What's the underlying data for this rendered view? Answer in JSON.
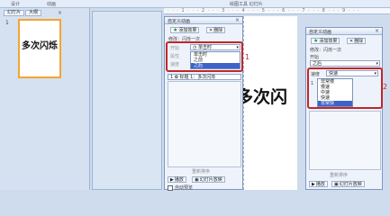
{
  "ribbon": {
    "title": "绘图工具 幻灯片",
    "tabs": [
      "设计",
      "动画"
    ]
  },
  "left_pane": {
    "tabs": [
      "幻灯片",
      "大纲"
    ],
    "close": "×",
    "thumbnail": {
      "number": "1",
      "text": "多次闪烁"
    }
  },
  "ruler": {
    "text": "· · · 1 · · · 2 · · · 3 · · · 4 · · · 5 · · · 6 · · · 7 · · · 8 · · · 9 · · ·"
  },
  "slide": {
    "text": "多次闪"
  },
  "panel1": {
    "title": "自定义动画",
    "close": "×",
    "add_effect": "添加效果",
    "remove": "删除",
    "modify_label": "修改：闪烁一次",
    "start_label": "开始",
    "start_value": "单击时",
    "property_label": "属性",
    "speed_label": "速度",
    "start_options": [
      "单击时",
      "之前",
      "之后"
    ],
    "selected_option": "之后",
    "list_item": "1  ✿ 标题 1：多次闪烁",
    "reorder": "重新排序",
    "play": "播放",
    "slideshow": "幻灯片放映",
    "autopreview": "自动预览",
    "callout": "1"
  },
  "panel2": {
    "title": "自定义动画",
    "close": "×",
    "add_effect": "添加效果",
    "remove": "删除",
    "modify_label": "修改：闪烁一次",
    "start_label": "开始",
    "start_value": "之后",
    "speed_label": "速度",
    "speed_value": "快速",
    "speed_options": [
      "非常慢",
      "慢速",
      "中速",
      "快速",
      "非常快"
    ],
    "selected_option": "快速",
    "list_prefix": "1",
    "reorder": "重新排序",
    "play": "播放",
    "slideshow": "幻灯片放映",
    "callout": "2"
  },
  "colors": {
    "highlight": "#c0262b",
    "selection": "#3d63c8",
    "thumbnail_border": "#f2a531"
  }
}
